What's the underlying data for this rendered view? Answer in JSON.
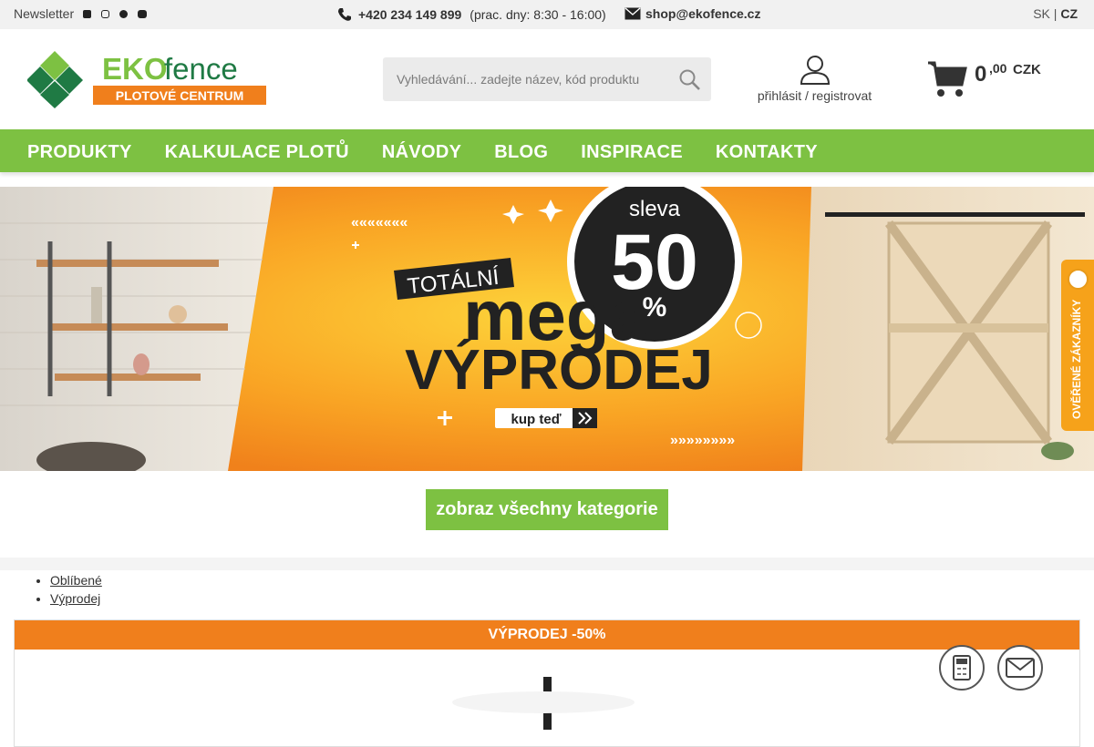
{
  "topbar": {
    "newsletter": "Newsletter",
    "social_icons": [
      "facebook-icon",
      "instagram-icon",
      "pinterest-icon",
      "youtube-icon"
    ],
    "phone": "+420 234 149 899",
    "hours": "(prac. dny: 8:30 - 16:00)",
    "email": "shop@ekofence.cz",
    "lang_sk": "SK",
    "lang_sep": "|",
    "lang_cz": "CZ"
  },
  "header": {
    "logo_brand_eko": "EKO",
    "logo_brand_fence": "fence",
    "logo_tagline": "PLOTOVÉ CENTRUM",
    "search_placeholder": "Vyhledávání... zadejte název, kód produktu",
    "account_label": "přihlásit / registrovat",
    "cart_amount": "0",
    "cart_cents": ",00",
    "cart_currency": "CZK"
  },
  "nav": {
    "items": [
      "PRODUKTY",
      "KALKULACE PLOTŮ",
      "NÁVODY",
      "BLOG",
      "INSPIRACE",
      "KONTAKTY"
    ]
  },
  "banner": {
    "line_totalni": "TOTÁLNÍ",
    "line_mega": "mega",
    "line_vyprodej": "VÝPRODEJ",
    "sleva": "sleva",
    "percent_value": "50",
    "percent_sign": "%",
    "cta": "kup teď"
  },
  "verified_tab": "OVĚŘENÉ ZÁKAZNÍKY",
  "categories_button": "zobraz všechny kategorie",
  "links": [
    "Oblíbené",
    "Výprodej"
  ],
  "sale_header": "VÝPRODEJ -50%",
  "colors": {
    "brand_green": "#7dc142",
    "orange": "#f07f1c",
    "dark": "#333333"
  }
}
